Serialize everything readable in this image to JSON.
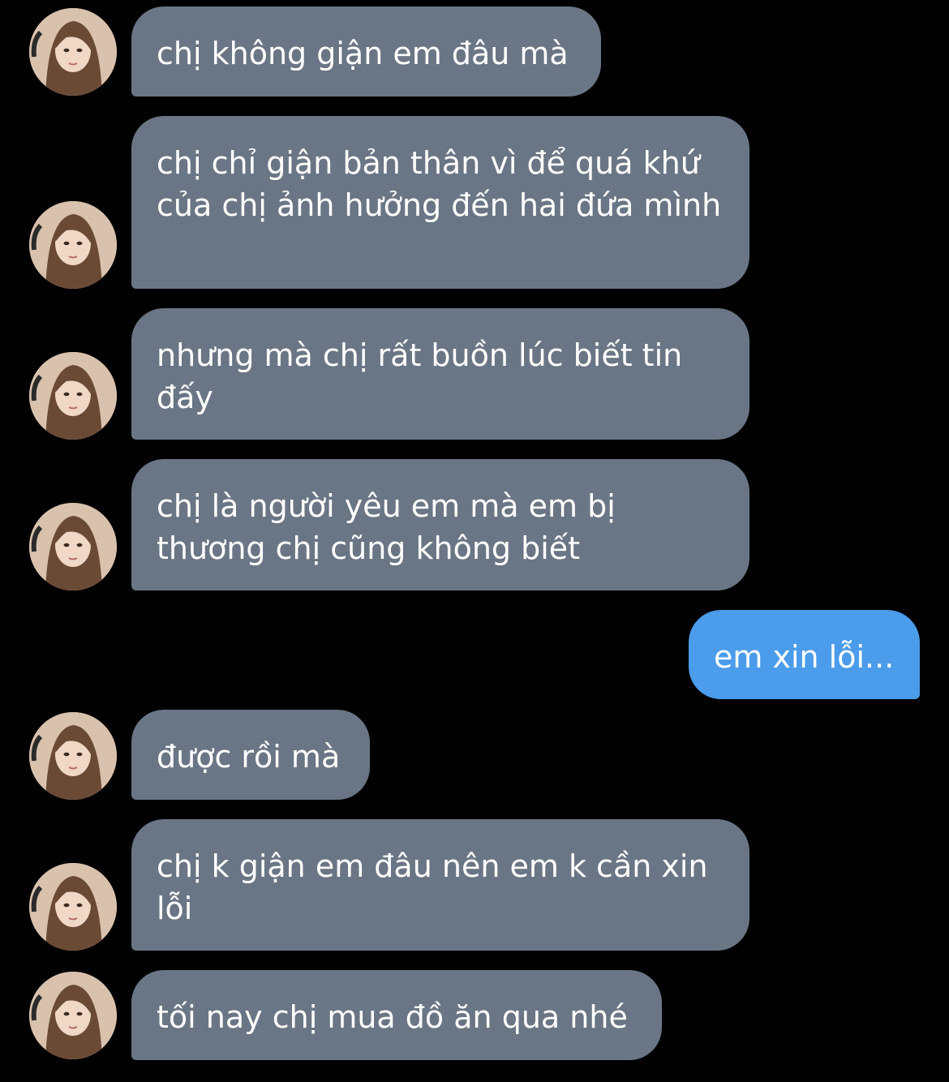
{
  "messages": [
    {
      "direction": "in",
      "text": "chị không giận em đâu mà"
    },
    {
      "direction": "in",
      "text": "chị chỉ giận bản thân vì để quá khứ của chị ảnh hưởng đến hai đứa mình"
    },
    {
      "direction": "in",
      "text": "nhưng mà chị rất buồn lúc biết tin đấy"
    },
    {
      "direction": "in",
      "text": "chị là người yêu em mà em bị thương chị cũng không biết"
    },
    {
      "direction": "out",
      "text": "em xin lỗi..."
    },
    {
      "direction": "in",
      "text": "được rồi mà"
    },
    {
      "direction": "in",
      "text": "chị k giận em đâu nên em k cần xin lỗi"
    },
    {
      "direction": "in",
      "text": "tối nay chị mua đồ ăn qua nhé"
    }
  ],
  "colors": {
    "background": "#000000",
    "incoming_bubble": "#6a7685",
    "outgoing_bubble": "#4b9cea",
    "text": "#ffffff"
  },
  "icons": {
    "avatar": "contact-avatar-photo"
  }
}
